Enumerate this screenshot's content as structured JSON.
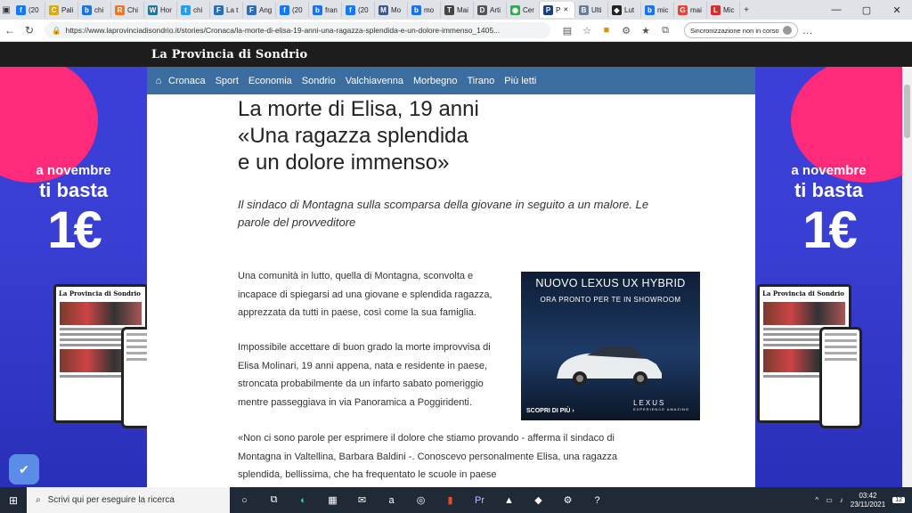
{
  "browser": {
    "tabs": [
      {
        "label": "(20",
        "icon": "facebook-icon",
        "color": "#1877f2",
        "glyph": "f"
      },
      {
        "label": "Pali",
        "icon": "c-icon",
        "color": "#e0a800",
        "glyph": "C"
      },
      {
        "label": "chi",
        "icon": "b-icon",
        "color": "#1a73e8",
        "glyph": "b"
      },
      {
        "label": "Chi",
        "icon": "r-icon",
        "color": "#f47521",
        "glyph": "R"
      },
      {
        "label": "Hor",
        "icon": "wordpress-icon",
        "color": "#21759b",
        "glyph": "W"
      },
      {
        "label": "chi",
        "icon": "twitter-icon",
        "color": "#1da1f2",
        "glyph": "t"
      },
      {
        "label": "La t",
        "icon": "f-icon",
        "color": "#2d6db5",
        "glyph": "F"
      },
      {
        "label": "Ang",
        "icon": "f-icon",
        "color": "#2d6db5",
        "glyph": "F"
      },
      {
        "label": "(20",
        "icon": "facebook-icon",
        "color": "#1877f2",
        "glyph": "f"
      },
      {
        "label": "fran",
        "icon": "b-icon",
        "color": "#1a73e8",
        "glyph": "b"
      },
      {
        "label": "(20",
        "icon": "facebook-icon",
        "color": "#1877f2",
        "glyph": "f"
      },
      {
        "label": "Mo",
        "icon": "m-icon",
        "color": "#3b5998",
        "glyph": "M"
      },
      {
        "label": "mo",
        "icon": "b-icon",
        "color": "#1a73e8",
        "glyph": "b"
      },
      {
        "label": "Mai",
        "icon": "t-icon",
        "color": "#444444",
        "glyph": "T"
      },
      {
        "label": "Arti",
        "icon": "dh-icon",
        "color": "#555555",
        "glyph": "D"
      },
      {
        "label": "Cer",
        "icon": "maps-icon",
        "color": "#34a853",
        "glyph": "◉"
      },
      {
        "label": "P",
        "icon": "p-icon",
        "color": "#1d3f7a",
        "glyph": "P",
        "active": true
      },
      {
        "label": "Ulti",
        "icon": "bs-icon",
        "color": "#6a7d92",
        "glyph": "B"
      },
      {
        "label": "Lut",
        "icon": "dark-icon",
        "color": "#222222",
        "glyph": "◆"
      },
      {
        "label": "mic",
        "icon": "b-icon",
        "color": "#1a73e8",
        "glyph": "b"
      },
      {
        "label": "mai",
        "icon": "google-icon",
        "color": "#ea4335",
        "glyph": "G"
      },
      {
        "label": "Mic",
        "icon": "l-icon",
        "color": "#d32f2f",
        "glyph": "L"
      }
    ],
    "url": "https://www.laprovinciadisondrio.it/stories/Cronaca/la-morte-di-elisa-19-anni-una-ragazza-splendida-e-un-dolore-immenso_1405...",
    "sync_label": "Sincronizzazione non in corso"
  },
  "site": {
    "logo": "La Provincia di Sondrio",
    "nav": [
      "Cronaca",
      "Sport",
      "Economia",
      "Sondrio",
      "Valchiavenna",
      "Morbegno",
      "Tirano",
      "Più letti"
    ]
  },
  "article": {
    "headline_lines": [
      "La morte di Elisa, 19 anni",
      "«Una ragazza splendida",
      "e un dolore immenso»"
    ],
    "subhead": "Il sindaco di Montagna sulla scomparsa della giovane in seguito a un malore. Le parole del provveditore",
    "paragraphs": [
      "Una comunità in lutto, quella di Montagna, sconvolta e incapace di spiegarsi ad una giovane e splendida ragazza, apprezzata da tutti in paese, così come la sua famiglia.",
      "Impossibile accettare di buon grado la morte improvvisa di Elisa Molinari, 19 anni appena, nata e residente in paese, stroncata probabilmente da un infarto sabato pomeriggio mentre passeggiava in via Panoramica a Poggiridenti.",
      "«Non ci sono parole per esprimere il dolore che stiamo provando - afferma il sindaco di Montagna in Valtellina, Barbara Baldini -. Conoscevo personalmente Elisa, una ragazza splendida, bellissima, che ha frequentato le scuole in paese"
    ]
  },
  "ads": {
    "side": {
      "line1": "a novembre",
      "line2": "ti basta",
      "price": "1€",
      "paper_title": "La Provincia di Sondrio"
    },
    "lexus": {
      "title": "NUOVO LEXUS UX HYBRID",
      "subtitle": "ORA PRONTO PER TE IN SHOWROOM",
      "cta": "SCOPRI DI PIÙ ›",
      "brand": "LEXUS",
      "tagline": "EXPERIENCE AMAZING"
    }
  },
  "taskbar": {
    "search_placeholder": "Scrivi qui per eseguire la ricerca",
    "time": "03:42",
    "date": "23/11/2021",
    "notifications": "12"
  },
  "colors": {
    "nav_blue": "#3c6da0",
    "ad_blue": "#3a3fd4",
    "ad_pink": "#ff2a7a"
  }
}
